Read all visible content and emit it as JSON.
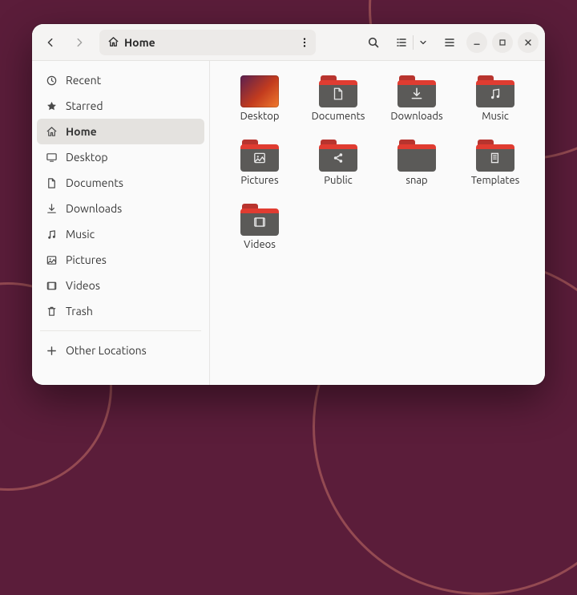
{
  "header": {
    "location_label": "Home"
  },
  "sidebar": {
    "items": [
      {
        "label": "Recent",
        "icon": "clock-icon",
        "active": false
      },
      {
        "label": "Starred",
        "icon": "star-icon",
        "active": false
      },
      {
        "label": "Home",
        "icon": "home-icon",
        "active": true
      },
      {
        "label": "Desktop",
        "icon": "desktop-icon",
        "active": false
      },
      {
        "label": "Documents",
        "icon": "document-icon",
        "active": false
      },
      {
        "label": "Downloads",
        "icon": "download-icon",
        "active": false
      },
      {
        "label": "Music",
        "icon": "music-icon",
        "active": false
      },
      {
        "label": "Pictures",
        "icon": "picture-icon",
        "active": false
      },
      {
        "label": "Videos",
        "icon": "video-icon",
        "active": false
      },
      {
        "label": "Trash",
        "icon": "trash-icon",
        "active": false
      }
    ],
    "other_locations_label": "Other Locations"
  },
  "grid": {
    "items": [
      {
        "label": "Desktop",
        "kind": "desktop"
      },
      {
        "label": "Documents",
        "kind": "folder",
        "glyph": "document"
      },
      {
        "label": "Downloads",
        "kind": "folder",
        "glyph": "download"
      },
      {
        "label": "Music",
        "kind": "folder",
        "glyph": "music"
      },
      {
        "label": "Pictures",
        "kind": "folder",
        "glyph": "picture"
      },
      {
        "label": "Public",
        "kind": "folder",
        "glyph": "share"
      },
      {
        "label": "snap",
        "kind": "folder",
        "glyph": "none"
      },
      {
        "label": "Templates",
        "kind": "folder",
        "glyph": "template"
      },
      {
        "label": "Videos",
        "kind": "folder",
        "glyph": "video"
      }
    ]
  },
  "colors": {
    "folder_accent": "#e03c31",
    "folder_body": "#5b5a58",
    "wallpaper": "#5b1d3a"
  }
}
